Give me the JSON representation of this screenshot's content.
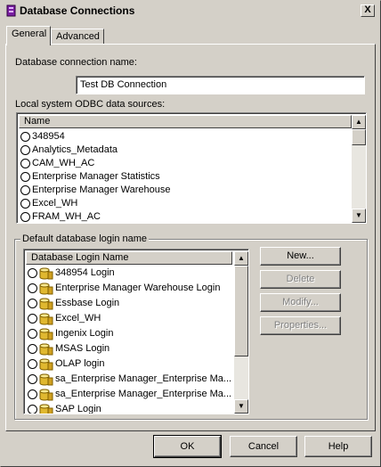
{
  "window": {
    "title": "Database Connections",
    "close_glyph": "X"
  },
  "tabs": [
    {
      "label": "General"
    },
    {
      "label": "Advanced"
    }
  ],
  "connection_name": {
    "label": "Database connection name:",
    "value": "Test DB Connection"
  },
  "odbc": {
    "label": "Local system ODBC data sources:",
    "column_header": "Name",
    "items": [
      "348954",
      "Analytics_Metadata",
      "CAM_WH_AC",
      "Enterprise Manager Statistics",
      "Enterprise Manager Warehouse",
      "Excel_WH",
      "FRAM_WH_AC"
    ]
  },
  "login_group": {
    "label": "Default database login name",
    "column_header": "Database Login Name",
    "items": [
      "348954 Login",
      "Enterprise Manager Warehouse Login",
      "Essbase Login",
      "Excel_WH",
      "Ingenix Login",
      "MSAS Login",
      "OLAP login",
      "sa_Enterprise Manager_Enterprise Ma...",
      "sa_Enterprise Manager_Enterprise Ma...",
      "SAP Login"
    ],
    "buttons": {
      "new": "New...",
      "delete": "Delete",
      "modify": "Modify...",
      "properties": "Properties..."
    }
  },
  "footer": {
    "ok": "OK",
    "cancel": "Cancel",
    "help": "Help"
  },
  "icons": {
    "window": "database-connections-icon",
    "radio": "radio-button-icon",
    "db": "database-icon"
  }
}
